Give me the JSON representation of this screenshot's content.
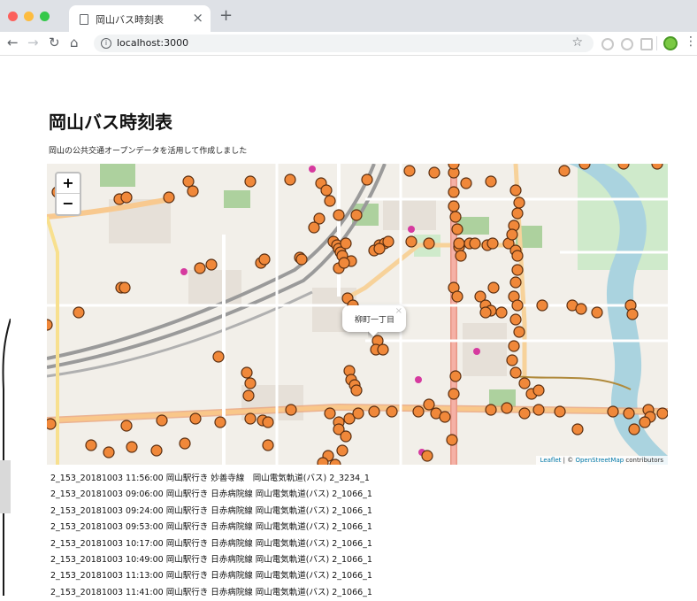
{
  "browser": {
    "tab_title": "岡山バス時刻表",
    "url": "localhost:3000",
    "traffic_light_colors": [
      "#fc605c",
      "#fdbc40",
      "#34c84a"
    ],
    "icons": [
      "page-icon",
      "close-icon",
      "plus-icon",
      "back-arrow-icon",
      "forward-arrow-icon",
      "reload-icon",
      "home-icon",
      "info-icon",
      "star-icon",
      "extension-icon",
      "menu-icon"
    ]
  },
  "page": {
    "title": "岡山バス時刻表",
    "subtitle": "岡山の公共交通オープンデータを活用して作成しました"
  },
  "map": {
    "zoom_in": "+",
    "zoom_out": "−",
    "popup_text": "柳町一丁目",
    "popup_close": "×",
    "attribution_leaflet": "Leaflet",
    "attribution_sep": " | © ",
    "attribution_osm": "OpenStreetMap",
    "attribution_tail": " contributors",
    "marker_color": "#f0883a",
    "marker_stroke": "#5a2e10"
  },
  "trips": [
    "2_153_20181003 11:56:00 岡山駅行き 妙善寺線　岡山電気軌道(バス) 2_3234_1",
    "2_153_20181003 09:06:00 岡山駅行き 日赤病院線 岡山電気軌道(バス) 2_1066_1",
    "2_153_20181003 09:24:00 岡山駅行き 日赤病院線 岡山電気軌道(バス) 2_1066_1",
    "2_153_20181003 09:53:00 岡山駅行き 日赤病院線 岡山電気軌道(バス) 2_1066_1",
    "2_153_20181003 10:17:00 岡山駅行き 日赤病院線 岡山電気軌道(バス) 2_1066_1",
    "2_153_20181003 10:49:00 岡山駅行き 日赤病院線 岡山電気軌道(バス) 2_1066_1",
    "2_153_20181003 11:13:00 岡山駅行き 日赤病院線 岡山電気軌道(バス) 2_1066_1",
    "2_153_20181003 11:41:00 岡山駅行き 日赤病院線 岡山電気軌道(バス) 2_1066_1"
  ]
}
